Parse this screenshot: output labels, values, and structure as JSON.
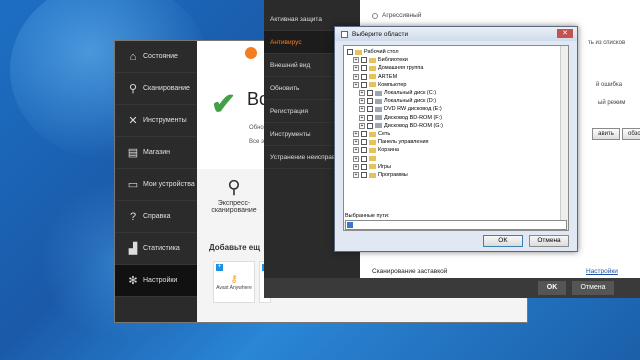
{
  "avast": {
    "sidebar": [
      {
        "label": "Состояние",
        "icon": "home-icon"
      },
      {
        "label": "Сканирование",
        "icon": "search-icon"
      },
      {
        "label": "Инструменты",
        "icon": "tools-icon"
      },
      {
        "label": "Магазин",
        "icon": "cart-icon"
      },
      {
        "label": "Мои устройства",
        "icon": "monitor-icon"
      },
      {
        "label": "Справка",
        "icon": "help-icon"
      },
      {
        "label": "Статистика",
        "icon": "chart-icon"
      },
      {
        "label": "Настройки",
        "icon": "gear-icon"
      }
    ],
    "state_title": "Вс",
    "line1": "Обно",
    "line2": "Все э",
    "express_label": "Экспресс-сканирование",
    "add_more": "Добавьте ещ",
    "tile1": "Avast Anywhere"
  },
  "settings": {
    "sidebar": [
      {
        "label": "Активная защита"
      },
      {
        "label": "Антивирус"
      },
      {
        "label": "Внешний вид"
      },
      {
        "label": "Обновить"
      },
      {
        "label": "Регистрация"
      },
      {
        "label": "Инструменты"
      },
      {
        "label": "Устранение неисправ"
      }
    ],
    "radio_label": "Агрессивный",
    "side_text1": "ть из списков",
    "side_text2": "й ошибка",
    "side_text3": "ый режим",
    "btn_add": "авить",
    "btn_browse": "обзор",
    "screensaver_label": "Сканирование заставкой",
    "settings_link": "Настройки",
    "ok": "OK",
    "cancel": "Отмена"
  },
  "dialog": {
    "title": "Выберите области",
    "close": "✕",
    "tree": [
      {
        "label": "Рабочий стол",
        "level": 0
      },
      {
        "label": "Библиотеки",
        "level": 1
      },
      {
        "label": "Домашняя группа",
        "level": 1
      },
      {
        "label": "ARTEM",
        "level": 1
      },
      {
        "label": "Компьютер",
        "level": 1
      },
      {
        "label": "Локальный диск (C:)",
        "level": 2
      },
      {
        "label": "Локальный диск (D:)",
        "level": 2
      },
      {
        "label": "DVD RW дисковод (E:)",
        "level": 2
      },
      {
        "label": "Дисковод BD-ROM (F:)",
        "level": 2
      },
      {
        "label": "Дисковод BD-ROM (G:)",
        "level": 2
      },
      {
        "label": "Сеть",
        "level": 1
      },
      {
        "label": "Панель управления",
        "level": 1
      },
      {
        "label": "Корзина",
        "level": 1
      },
      {
        "label": "",
        "level": 1
      },
      {
        "label": "Игры",
        "level": 1
      },
      {
        "label": "Программы",
        "level": 1
      }
    ],
    "paths_label": "Выбранные пути:",
    "ok": "OK",
    "cancel": "Отмена"
  }
}
